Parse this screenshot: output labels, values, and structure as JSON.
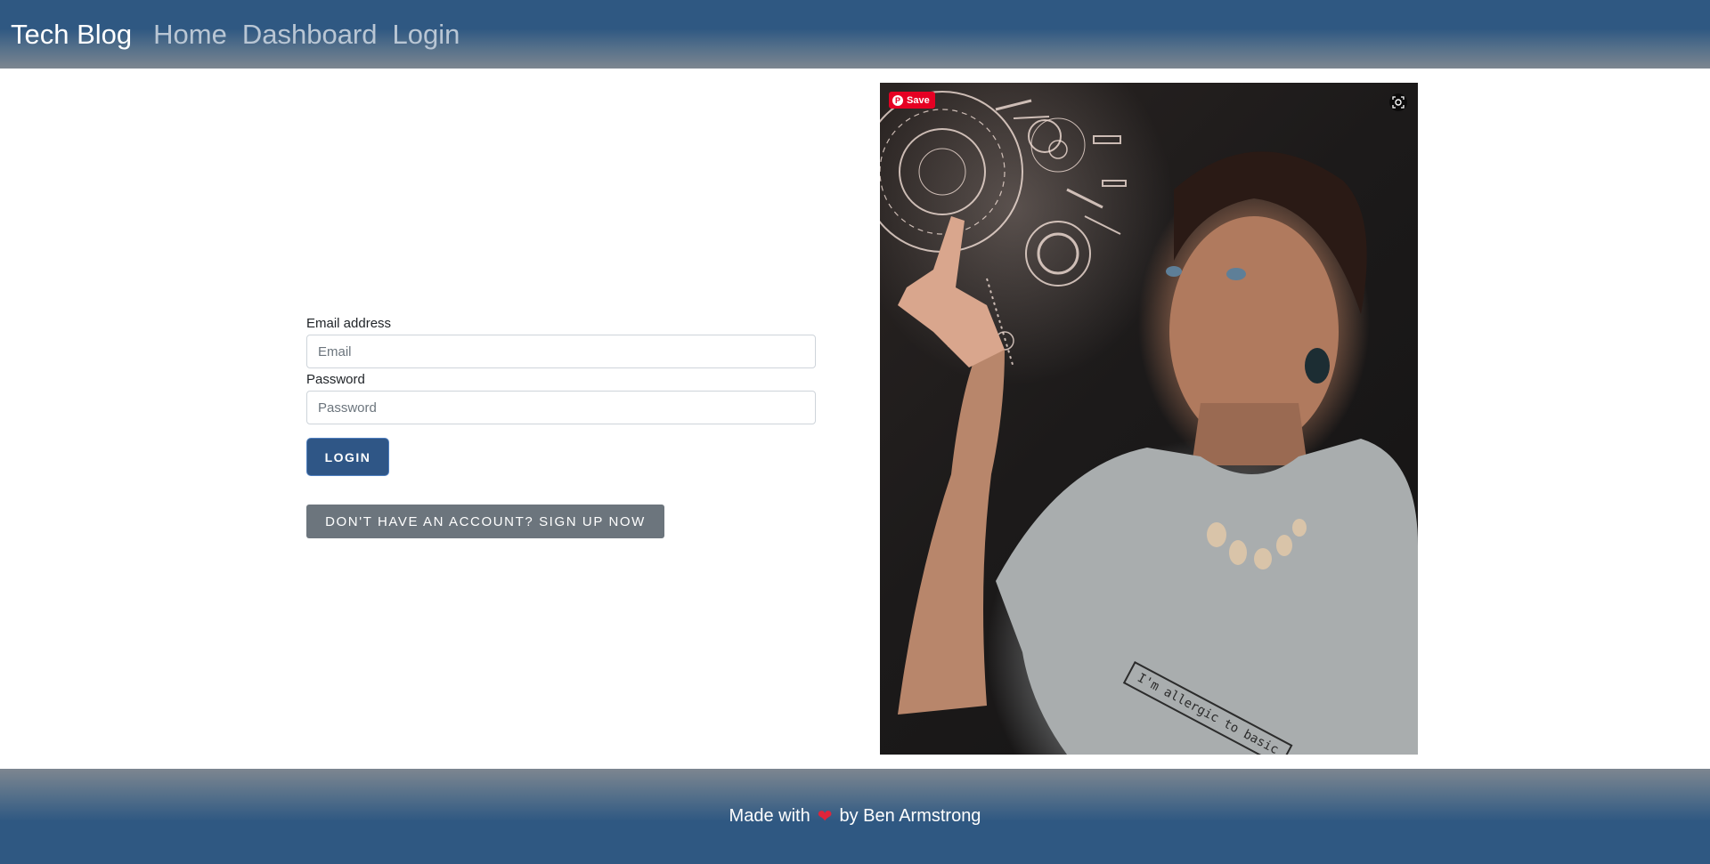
{
  "navbar": {
    "brand": "Tech Blog",
    "links": [
      "Home",
      "Dashboard",
      "Login"
    ]
  },
  "form": {
    "email_label": "Email address",
    "email_placeholder": "Email",
    "email_value": "",
    "password_label": "Password",
    "password_placeholder": "Password",
    "password_value": "",
    "login_button": "LOGIN",
    "signup_button": "DON'T HAVE AN ACCOUNT? SIGN UP NOW"
  },
  "hero": {
    "save_label": "Save",
    "shirt_text": "I'm allergic to basic",
    "icons": [
      "pinterest-icon",
      "visual-search-icon"
    ]
  },
  "footer": {
    "text_before": "Made with",
    "heart_icon": "heart-icon",
    "text_after": "by Ben Armstrong"
  },
  "colors": {
    "nav_blue": "#2f5882",
    "login_button": "#2f5686",
    "signup_button": "#6c757d",
    "pinterest_red": "#e60023"
  }
}
